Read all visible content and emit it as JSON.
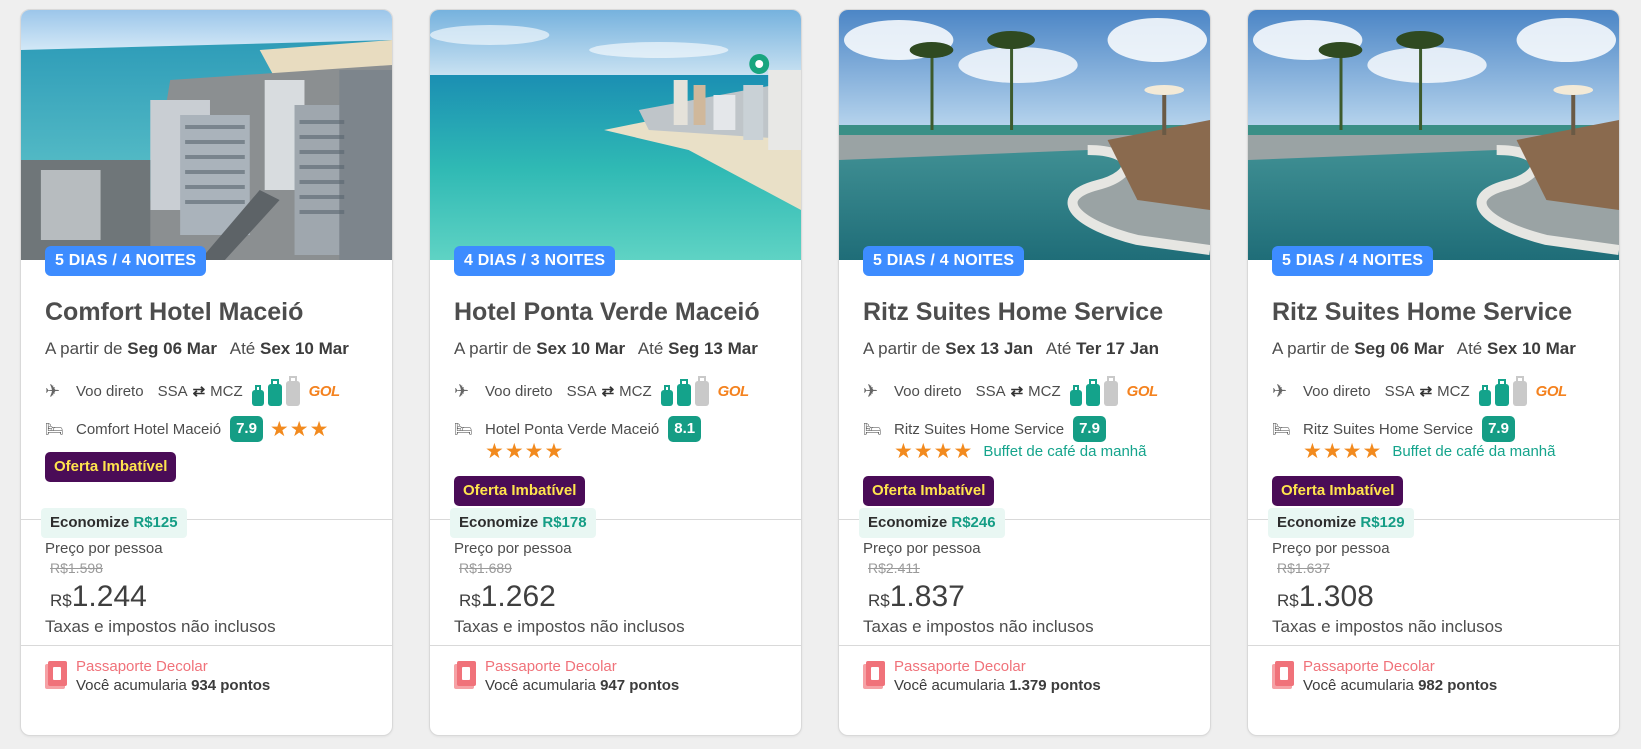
{
  "cards": [
    {
      "duration_badge": "5 DIAS / 4 NOITES",
      "hotel_name": "Comfort Hotel Maceió",
      "dates": {
        "from_label": "A partir de",
        "from_date": "Seg 06 Mar",
        "until_label": "Até",
        "until_date": "Sex 10 Mar"
      },
      "flight": {
        "type": "Voo direto",
        "origin": "SSA",
        "destination": "MCZ",
        "airline": "GOL"
      },
      "hotel": {
        "name": "Comfort Hotel Maceió",
        "score": "7.9",
        "stars": 3,
        "amenity": ""
      },
      "offer_label": "Oferta Imbatível",
      "savings": {
        "label": "Economize",
        "amount": "R$125"
      },
      "price": {
        "per_person_label": "Preço por pessoa",
        "old_price": "R$1.598",
        "currency": "R$",
        "value": "1.244",
        "taxes_note": "Taxas e impostos não inclusos"
      },
      "passport": {
        "title": "Passaporte Decolar",
        "prefix": "Você acumularia",
        "points": "934 pontos"
      }
    },
    {
      "duration_badge": "4 DIAS / 3 NOITES",
      "hotel_name": "Hotel Ponta Verde Maceió",
      "dates": {
        "from_label": "A partir de",
        "from_date": "Sex 10 Mar",
        "until_label": "Até",
        "until_date": "Seg 13 Mar"
      },
      "flight": {
        "type": "Voo direto",
        "origin": "SSA",
        "destination": "MCZ",
        "airline": "GOL"
      },
      "hotel": {
        "name": "Hotel Ponta Verde Maceió",
        "score": "8.1",
        "stars": 4,
        "amenity": ""
      },
      "offer_label": "Oferta Imbatível",
      "savings": {
        "label": "Economize",
        "amount": "R$178"
      },
      "price": {
        "per_person_label": "Preço por pessoa",
        "old_price": "R$1.689",
        "currency": "R$",
        "value": "1.262",
        "taxes_note": "Taxas e impostos não inclusos"
      },
      "passport": {
        "title": "Passaporte Decolar",
        "prefix": "Você acumularia",
        "points": "947 pontos"
      }
    },
    {
      "duration_badge": "5 DIAS / 4 NOITES",
      "hotel_name": "Ritz Suites Home Service",
      "dates": {
        "from_label": "A partir de",
        "from_date": "Sex 13 Jan",
        "until_label": "Até",
        "until_date": "Ter 17 Jan"
      },
      "flight": {
        "type": "Voo direto",
        "origin": "SSA",
        "destination": "MCZ",
        "airline": "GOL"
      },
      "hotel": {
        "name": "Ritz Suites Home Service",
        "score": "7.9",
        "stars": 4,
        "amenity": "Buffet de café da manhã"
      },
      "offer_label": "Oferta Imbatível",
      "savings": {
        "label": "Economize",
        "amount": "R$246"
      },
      "price": {
        "per_person_label": "Preço por pessoa",
        "old_price": "R$2.411",
        "currency": "R$",
        "value": "1.837",
        "taxes_note": "Taxas e impostos não inclusos"
      },
      "passport": {
        "title": "Passaporte Decolar",
        "prefix": "Você acumularia",
        "points": "1.379 pontos"
      }
    },
    {
      "duration_badge": "5 DIAS / 4 NOITES",
      "hotel_name": "Ritz Suites Home Service",
      "dates": {
        "from_label": "A partir de",
        "from_date": "Seg 06 Mar",
        "until_label": "Até",
        "until_date": "Sex 10 Mar"
      },
      "flight": {
        "type": "Voo direto",
        "origin": "SSA",
        "destination": "MCZ",
        "airline": "GOL"
      },
      "hotel": {
        "name": "Ritz Suites Home Service",
        "score": "7.9",
        "stars": 4,
        "amenity": "Buffet de café da manhã"
      },
      "offer_label": "Oferta Imbatível",
      "savings": {
        "label": "Economize",
        "amount": "R$129"
      },
      "price": {
        "per_person_label": "Preço por pessoa",
        "old_price": "R$1.637",
        "currency": "R$",
        "value": "1.308",
        "taxes_note": "Taxas e impostos não inclusos"
      },
      "passport": {
        "title": "Passaporte Decolar",
        "prefix": "Você acumularia",
        "points": "982 pontos"
      }
    }
  ],
  "icons": {
    "flight": "plane-icon",
    "route": "swap-arrows-icon",
    "hotel": "bed-icon",
    "baggage": "luggage-icon",
    "passport": "passport-icon"
  },
  "colors": {
    "badge": "#3d8cff",
    "offer_bg": "#4a0c57",
    "offer_text": "#ffe44d",
    "score": "#159d85",
    "stars": "#f28a1e",
    "savings_bg": "#e9f7f3",
    "airline": "#f4821f",
    "passport": "#f0727a"
  }
}
